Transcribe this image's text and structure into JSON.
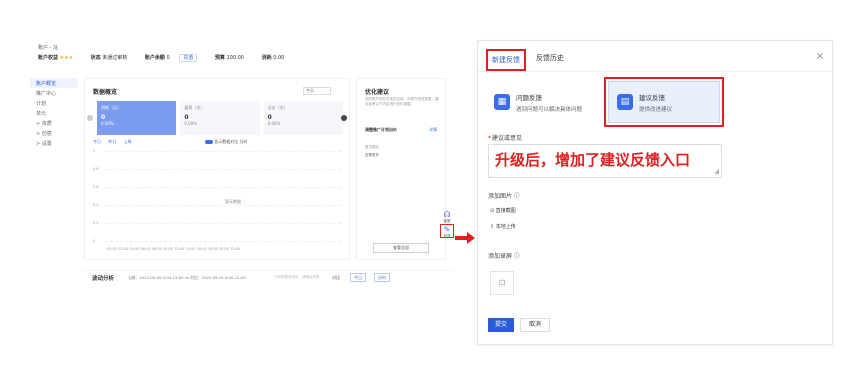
{
  "left": {
    "account_label": "账户 - 马",
    "stats": {
      "balance_label": "账户权益",
      "stars": "★★★",
      "status_label": "状态",
      "status_value": "未通过审核",
      "warn_label": "账户余额",
      "warn_value": "0",
      "warn_btn": "充值",
      "budget_label": "预算",
      "budget_value": "100.00",
      "bid_label": "消耗",
      "bid_value": "0.00"
    },
    "nav": [
      "账户概览",
      "推广中心",
      "计划",
      "单元",
      "> 资质",
      "> 创意",
      "> 设置"
    ],
    "main": {
      "title": "数据概览",
      "select": "今天",
      "cards": [
        {
          "label": "消耗（元）",
          "value": "0",
          "sub": "0.00%"
        },
        {
          "label": "展现（次）",
          "value": "0",
          "sub": "0.00%"
        },
        {
          "label": "点击（次）",
          "value": "0",
          "sub": "0.00%"
        }
      ],
      "legend": [
        "今日",
        "昨日",
        "上周"
      ],
      "legend_right": "显示数据对比  分时",
      "yticks": [
        "1",
        "0.8",
        "0.6",
        "0.4",
        "0.2",
        "0"
      ],
      "empty_tip": "暂无数据",
      "xaxis": "00:00 02:00 04:00 06:00 08:00 10:00 12:00 14:00 16:00 18:00 20:00 22:00"
    },
    "side": {
      "title": "优化建议",
      "desc": "您的账户存在可优化空间，为提升投放效果，建议参考以下内容进行优化调整。",
      "heading": "调整推广计划出价",
      "detail": "详情",
      "sub1": "暂无建议",
      "sub2": "查看更多",
      "button": "查看全部"
    },
    "tools": {
      "service": "客服",
      "feedback": "反馈"
    },
    "bottom": {
      "title": "波动分析",
      "range": "当前：2023-09-20 0:00-12:00 vs 对比：2023-09-19 0:00-12:00",
      "note": "分析数据有延迟，请稍后查看",
      "label": "对比",
      "btn1": "今日",
      "btn2": "分时"
    }
  },
  "dialog": {
    "tabs": [
      "新建反馈",
      "反馈历史"
    ],
    "close": "×",
    "options": [
      {
        "icon": "问题反馈-icon",
        "title": "问题反馈",
        "sub": "遇到问题可以解决具体问题"
      },
      {
        "icon": "建议反馈-icon",
        "title": "建议反馈",
        "sub": "提供改进建议"
      }
    ],
    "field_label": "建议或意见",
    "field_value": "升级后，增加了建议反馈入口",
    "add_image_label": "添加图片 ⓘ",
    "screenshot_link": "直接截图",
    "upload_link": "本地上传",
    "add_record_label": "添加录屏 ⓘ",
    "submit": "提交",
    "cancel": "取消"
  }
}
